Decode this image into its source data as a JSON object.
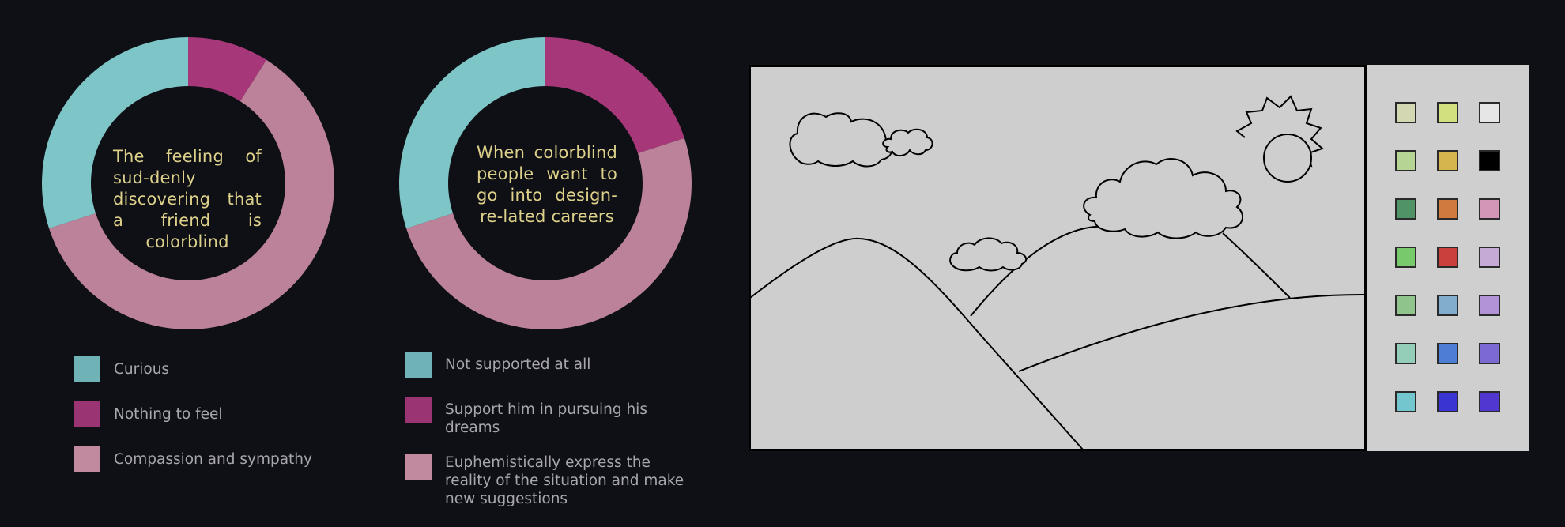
{
  "chart_data": [
    {
      "type": "pie",
      "title": "The feeling of suddenly discovering that a friend is colorblind",
      "center_text": "The feeling of sud-denly discovering that a friend is colorblind",
      "categories": [
        "Curious",
        "Nothing to feel",
        "Compassion and sympathy"
      ],
      "values": [
        30,
        9,
        61
      ],
      "colors": [
        "#7ec5c7",
        "#a6387a",
        "#bb8299"
      ],
      "start_order": [
        "Nothing to feel",
        "Compassion and sympathy",
        "Curious"
      ],
      "legend_position": "bottom",
      "donut": true
    },
    {
      "type": "pie",
      "title": "When colorblind people want to go into design-related careers",
      "center_text": "When colorblind people want to go into design-re-lated careers",
      "categories": [
        "Not supported at all",
        "Support him in pursuing his dreams",
        "Euphemistically express the reality of the situation and make new suggestions"
      ],
      "values": [
        30,
        20,
        50
      ],
      "colors": [
        "#7ec5c7",
        "#a6387a",
        "#bb8299"
      ],
      "start_order": [
        "Support him in pursuing his dreams",
        "Euphemistically express the reality of the situation and make new suggestions",
        "Not supported at all"
      ],
      "legend_position": "bottom",
      "donut": true
    }
  ],
  "legend1": [
    {
      "label": "Curious",
      "color": "#6fb3b6"
    },
    {
      "label": "Nothing to feel",
      "color": "#9a3472"
    },
    {
      "label": "Compassion and sympathy",
      "color": "#c28a9e"
    }
  ],
  "legend2": [
    {
      "label": "Not supported at all",
      "color": "#6fb3b6"
    },
    {
      "label": "Support him in pursuing his dreams",
      "color": "#9a3472"
    },
    {
      "label": "Euphemistically express the reality of the situation and make new suggestions",
      "color": "#c28a9e"
    }
  ],
  "palette": {
    "background": "#cfcfcf",
    "colors": [
      [
        "#d4d8b2",
        "#d3e07f",
        "#e6e6e6"
      ],
      [
        "#b6d494",
        "#d5b54e",
        "#000000"
      ],
      [
        "#4f9366",
        "#d07a3f",
        "#d396b6"
      ],
      [
        "#78c96c",
        "#c9403c",
        "#c4aad4"
      ],
      [
        "#8fc48d",
        "#82adcc",
        "#b393d8"
      ],
      [
        "#94cdb8",
        "#4d7ed5",
        "#7c6ad2"
      ],
      [
        "#73c6cd",
        "#3a34d2",
        "#5236d0"
      ]
    ]
  },
  "canvas": {
    "background": "#cecece",
    "icons": [
      "cloud-icon",
      "cloud-icon",
      "cloud-icon",
      "cloud-icon",
      "sun-icon",
      "hill-icon"
    ]
  }
}
